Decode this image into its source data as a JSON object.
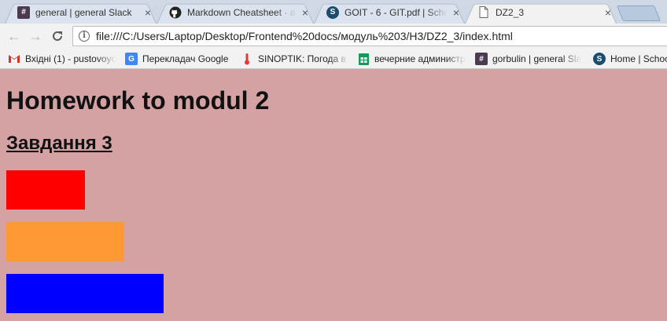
{
  "browser": {
    "tabs": [
      {
        "title": "general | general Slack",
        "icon": "slack-hash-icon",
        "active": false
      },
      {
        "title": "Markdown Cheatsheet · a",
        "icon": "github-icon",
        "active": false
      },
      {
        "title": "GOIT - 6 - GIT.pdf | Schoo",
        "icon": "schoology-icon",
        "active": false
      },
      {
        "title": "DZ2_3",
        "icon": "document-icon",
        "active": true
      }
    ],
    "close_glyph": "×",
    "address": "file:///C:/Users/Laptop/Desktop/Frontend%20docs/модуль%203/H3/DZ2_3/index.html",
    "bookmarks": [
      {
        "label": "Вхідні (1) - pustovoyo",
        "icon": "gmail-icon"
      },
      {
        "label": "Перекладач Google",
        "icon": "google-translate-icon"
      },
      {
        "label": "SINOPTIK: Погода в У",
        "icon": "thermometer-icon"
      },
      {
        "label": "вечерние администр",
        "icon": "google-sheets-icon"
      },
      {
        "label": "gorbulin | general Sla",
        "icon": "slack-hash-icon"
      },
      {
        "label": "Home | Schoo",
        "icon": "schoology-icon"
      }
    ]
  },
  "page": {
    "heading": "Homework to modul 2",
    "subheading": "Завдання 3",
    "blocks": [
      {
        "color": "#ff0000"
      },
      {
        "color": "#ff9933"
      },
      {
        "color": "#0000ff"
      }
    ]
  },
  "colors": {
    "page_background": "#d4a2a3",
    "tabstrip": "#cfd9e6",
    "toolbar": "#f2f2f2"
  }
}
